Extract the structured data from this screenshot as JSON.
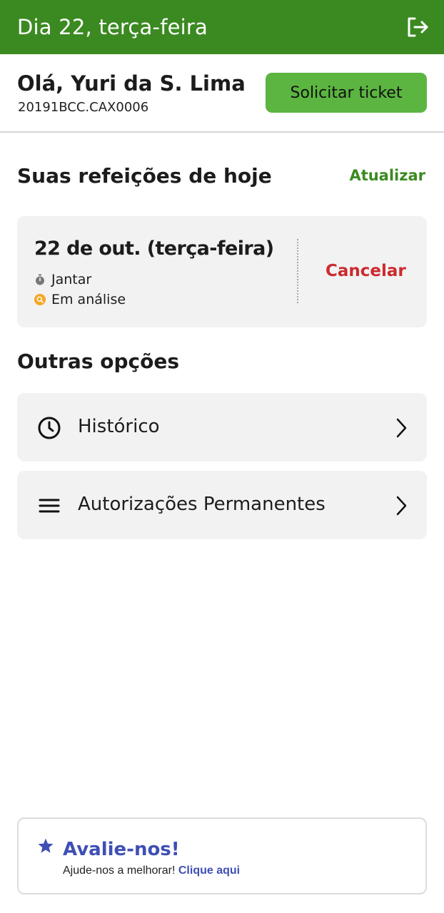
{
  "topbar": {
    "title": "Dia 22, terça-feira",
    "logout_icon": "logout-icon"
  },
  "user": {
    "greeting": "Olá, Yuri da S. Lima",
    "registration": "20191BCC.CAX0006",
    "request_button": "Solicitar ticket"
  },
  "meals_section": {
    "title": "Suas refeições de hoje",
    "refresh_label": "Atualizar",
    "card": {
      "date": "22 de out. (terça-feira)",
      "meal": "Jantar",
      "status": "Em análise",
      "cancel_label": "Cancelar"
    }
  },
  "other_options": {
    "title": "Outras opções",
    "items": [
      {
        "label": "Histórico",
        "icon": "clock-icon"
      },
      {
        "label": "Autorizações Permanentes",
        "icon": "menu-lines-icon"
      }
    ]
  },
  "rate_us": {
    "title": "Avalie-nos!",
    "text": "Ajude-nos a melhorar!",
    "link": "Clique aqui"
  },
  "colors": {
    "primary_green": "#3b8a21",
    "button_green": "#5bb540",
    "cancel_red": "#cc2a2f",
    "status_orange": "#f5a623",
    "rate_blue": "#3f4fb5"
  }
}
